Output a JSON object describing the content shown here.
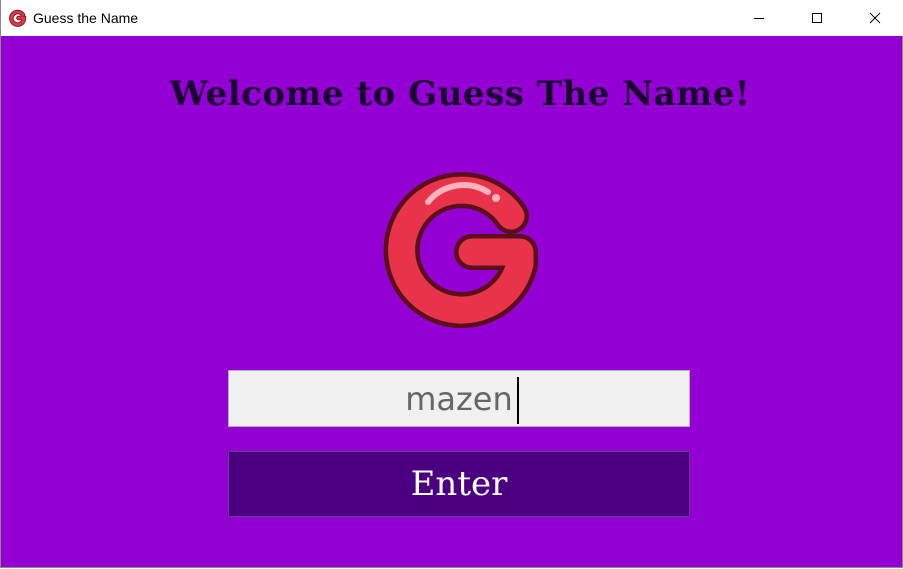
{
  "window": {
    "title": "Guess the Name",
    "app_icon": "g-logo-icon"
  },
  "controls": {
    "minimize_icon": "minimize-icon",
    "maximize_icon": "maximize-icon",
    "close_icon": "close-icon"
  },
  "main": {
    "welcome_text": "Welcome to Guess The Name!",
    "logo_icon": "g-logo-icon",
    "name_input_value": "mazen",
    "enter_label": "Enter"
  },
  "colors": {
    "background": "#9400d3",
    "button": "#4b0082",
    "logo_red": "#e8334a",
    "input_bg": "#f0f0f0"
  }
}
